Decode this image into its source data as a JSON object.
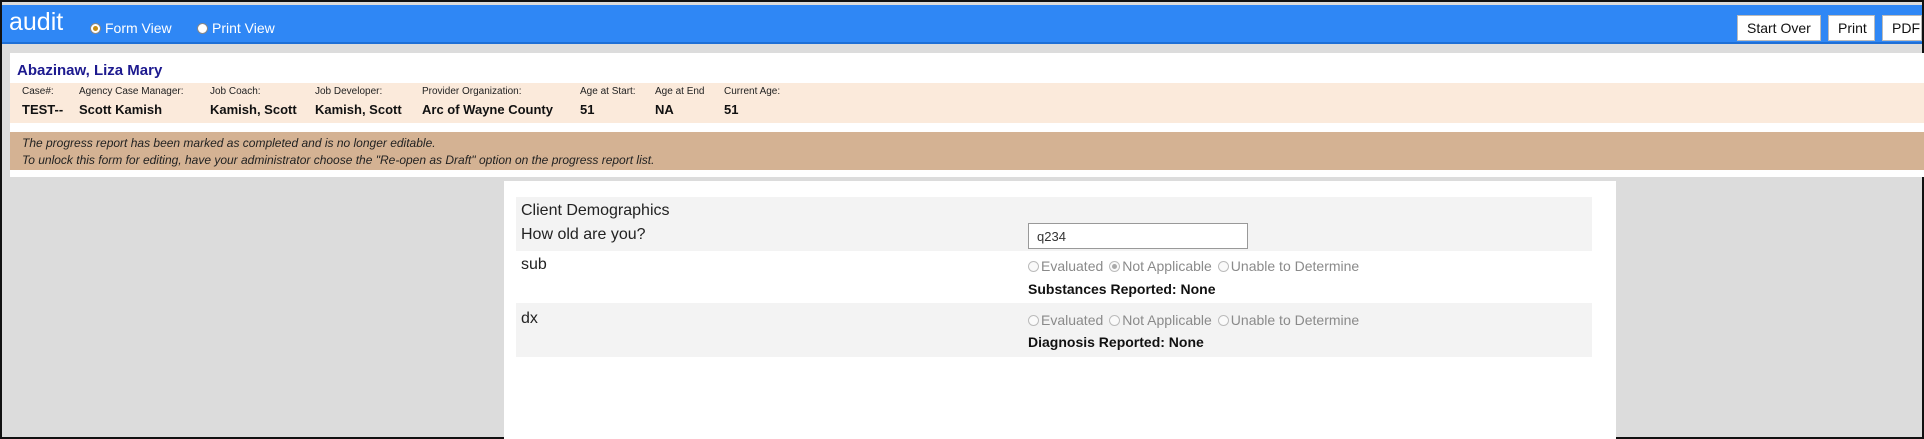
{
  "app": {
    "title": "audit"
  },
  "views": {
    "form_view": "Form View",
    "print_view": "Print View"
  },
  "toolbar": {
    "start_over": "Start Over",
    "print": "Print",
    "pdf": "PDF"
  },
  "client": {
    "name": "Abazinaw, Liza Mary",
    "fields": [
      {
        "label": "Case#:",
        "value": "TEST--"
      },
      {
        "label": "Agency Case Manager:",
        "value": "Scott Kamish"
      },
      {
        "label": "Job Coach:",
        "value": "Kamish, Scott"
      },
      {
        "label": "Job Developer:",
        "value": "Kamish, Scott"
      },
      {
        "label": "Provider Organization:",
        "value": "Arc of Wayne County"
      },
      {
        "label": "Age at Start:",
        "value": "51"
      },
      {
        "label": "Age at End",
        "value": "NA"
      },
      {
        "label": "Current Age:",
        "value": "51"
      }
    ]
  },
  "notice": {
    "line1": "The progress report has been marked as completed and is no longer editable.",
    "line2": "To unlock this form for editing, have your administrator choose the \"Re-open as Draft\" option on the progress report list."
  },
  "form": {
    "section_title": "Client Demographics",
    "q_age": {
      "label": "How old are you?",
      "value": "q234"
    },
    "q_sub": {
      "label": "sub",
      "options": [
        "Evaluated",
        "Not Applicable",
        "Unable to Determine"
      ],
      "reported": "Substances Reported: None"
    },
    "q_dx": {
      "label": "dx",
      "options": [
        "Evaluated",
        "Not Applicable",
        "Unable to Determine"
      ],
      "reported": "Diagnosis Reported: None"
    }
  }
}
